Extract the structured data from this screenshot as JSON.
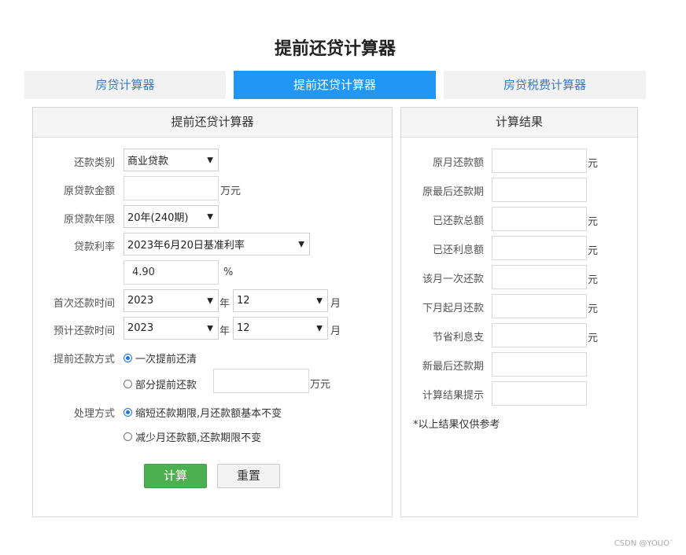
{
  "title": "提前还贷计算器",
  "tabs": [
    {
      "label": "房贷计算器"
    },
    {
      "label": "提前还贷计算器"
    },
    {
      "label": "房贷税费计算器"
    }
  ],
  "form": {
    "heading": "提前还贷计算器",
    "repayment_type": {
      "label": "还款类别",
      "value": "商业贷款"
    },
    "loan_amount": {
      "label": "原贷款金额",
      "value": "",
      "unit": "万元"
    },
    "loan_term": {
      "label": "原贷款年限",
      "value": "20年(240期)"
    },
    "rate": {
      "label": "贷款利率",
      "value": "2023年6月20日基准利率",
      "percent_value": "4.90",
      "percent_unit": "%"
    },
    "first_payment": {
      "label": "首次还款时间",
      "year": "2023",
      "year_unit": "年",
      "month": "12",
      "month_unit": "月"
    },
    "planned_payment": {
      "label": "预计还款时间",
      "year": "2023",
      "year_unit": "年",
      "month": "12",
      "month_unit": "月"
    },
    "prepay_method": {
      "label": "提前还款方式",
      "option_full": "一次提前还清",
      "option_partial": "部分提前还款",
      "partial_value": "",
      "partial_unit": "万元",
      "selected": "一次提前还清"
    },
    "handling": {
      "label": "处理方式",
      "option_shorten": "缩短还款期限,月还款额基本不变",
      "option_reduce": "减少月还款额,还款期限不变",
      "selected": "缩短还款期限,月还款额基本不变"
    },
    "calc_button": "计算",
    "reset_button": "重置"
  },
  "results": {
    "heading": "计算结果",
    "rows": [
      {
        "label": "原月还款额",
        "value": "",
        "unit": "元"
      },
      {
        "label": "原最后还款期",
        "value": "",
        "unit": ""
      },
      {
        "label": "已还款总额",
        "value": "",
        "unit": "元"
      },
      {
        "label": "已还利息额",
        "value": "",
        "unit": "元"
      },
      {
        "label": "该月一次还款",
        "value": "",
        "unit": "元"
      },
      {
        "label": "下月起月还款",
        "value": "",
        "unit": "元"
      },
      {
        "label": "节省利息支",
        "value": "",
        "unit": "元"
      },
      {
        "label": "新最后还款期",
        "value": "",
        "unit": ""
      },
      {
        "label": "计算结果提示",
        "value": "",
        "unit": ""
      }
    ],
    "note": "*以上结果仅供参考"
  },
  "credit": "CSDN @YOUO`",
  "colors": {
    "active_tab": "#2196f3",
    "tab_text": "#3a7cc4",
    "calc_button": "#4caf50"
  }
}
